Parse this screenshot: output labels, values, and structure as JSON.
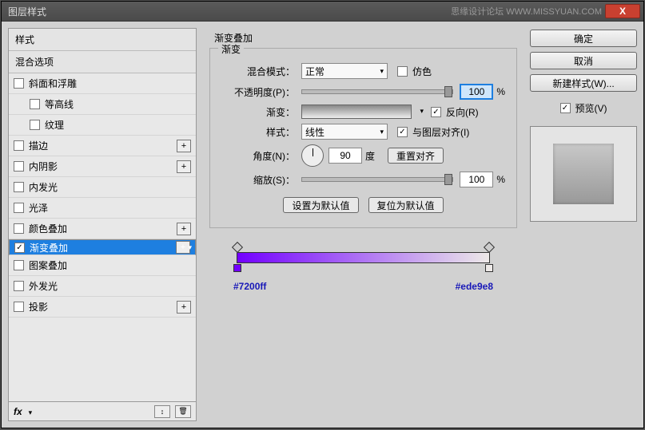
{
  "window": {
    "title": "图层样式",
    "watermark": "思缘设计论坛  WWW.MISSYUAN.COM",
    "close": "X"
  },
  "left": {
    "styles_header": "样式",
    "blending_header": "混合选项",
    "items": [
      {
        "label": "斜面和浮雕",
        "checked": false,
        "plus": false,
        "indent": false
      },
      {
        "label": "等高线",
        "checked": false,
        "plus": false,
        "indent": true
      },
      {
        "label": "纹理",
        "checked": false,
        "plus": false,
        "indent": true
      },
      {
        "label": "描边",
        "checked": false,
        "plus": true,
        "indent": false
      },
      {
        "label": "内阴影",
        "checked": false,
        "plus": true,
        "indent": false
      },
      {
        "label": "内发光",
        "checked": false,
        "plus": false,
        "indent": false
      },
      {
        "label": "光泽",
        "checked": false,
        "plus": false,
        "indent": false
      },
      {
        "label": "颜色叠加",
        "checked": false,
        "plus": true,
        "indent": false
      },
      {
        "label": "渐变叠加",
        "checked": true,
        "plus": true,
        "indent": false,
        "selected": true
      },
      {
        "label": "图案叠加",
        "checked": false,
        "plus": false,
        "indent": false
      },
      {
        "label": "外发光",
        "checked": false,
        "plus": false,
        "indent": false
      },
      {
        "label": "投影",
        "checked": false,
        "plus": true,
        "indent": false
      }
    ],
    "fx": "fx"
  },
  "center": {
    "section_title": "渐变叠加",
    "group_title": "渐变",
    "blend_mode_label": "混合模式：",
    "blend_mode_value": "正常",
    "dither_label": "仿色",
    "opacity_label": "不透明度(P)：",
    "opacity_value": "100",
    "percent": "%",
    "gradient_label": "渐变：",
    "reverse_label": "反向(R)",
    "style_label": "样式：",
    "style_value": "线性",
    "align_label": "与图层对齐(I)",
    "angle_label": "角度(N)：",
    "angle_value": "90",
    "angle_unit": "度",
    "reset_align": "重置对齐",
    "scale_label": "缩放(S)：",
    "scale_value": "100",
    "set_default": "设置为默认值",
    "reset_default": "复位为默认值",
    "hex_left": "#7200ff",
    "hex_right": "#ede9e8"
  },
  "right": {
    "ok": "确定",
    "cancel": "取消",
    "new_style": "新建样式(W)...",
    "preview": "预览(V)"
  }
}
